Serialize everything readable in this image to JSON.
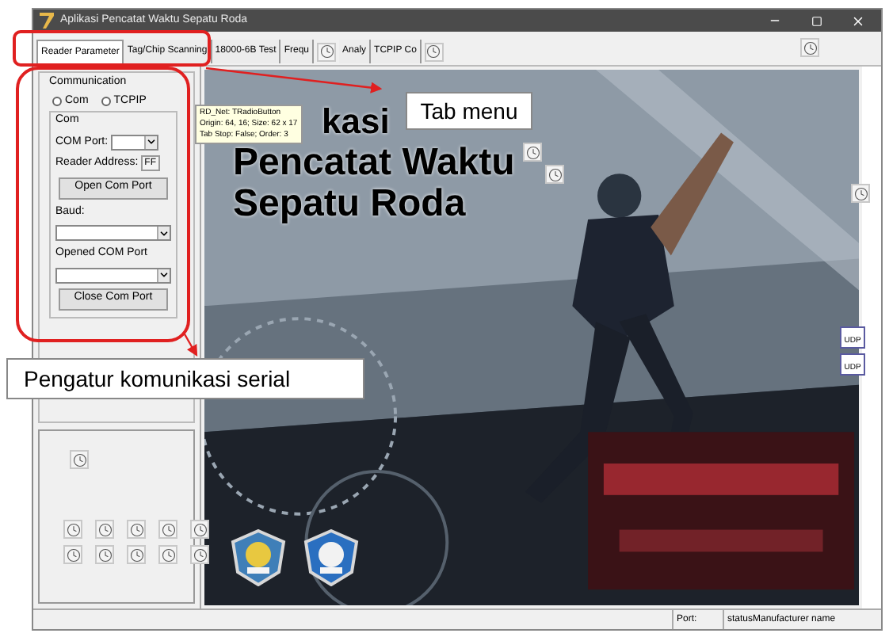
{
  "window": {
    "title": "Aplikasi Pencatat Waktu Sepatu Roda"
  },
  "tabs": [
    {
      "label": "Reader Parameter",
      "selected": true
    },
    {
      "label": "Tag/Chip Scanning",
      "selected": false
    },
    {
      "label": "18000-6B Test",
      "selected": false
    },
    {
      "label": "Frequ",
      "selected": false
    },
    {
      "label": "Analy",
      "selected": false
    },
    {
      "label": "TCPIP Co",
      "selected": false
    }
  ],
  "communication": {
    "title": "Communication",
    "radios": [
      {
        "label": "Com",
        "selected": false
      },
      {
        "label": "TCPIP",
        "selected": false
      }
    ],
    "com_group": {
      "title": "Com",
      "com_port_label": "COM Port:",
      "reader_address_label": "Reader Address:",
      "reader_address_value": "FF",
      "open_button": "Open Com Port",
      "baud_label": "Baud:",
      "opened_port_label": "Opened COM Port",
      "close_button": "Close Com Port"
    }
  },
  "tooltip": {
    "lines": [
      "RD_Net: TRadioButton",
      "Origin: 64, 16; Size: 62 x 17",
      "Tab Stop: False; Order: 3"
    ]
  },
  "banner": {
    "lines": [
      "kasi",
      "Pencatat Waktu",
      "Sepatu Roda"
    ]
  },
  "udp_components": [
    {
      "label": "UDP"
    },
    {
      "label": "UDP"
    }
  ],
  "status_bar": {
    "port_label": "Port:",
    "manufacturer": "statusManufacturer name"
  },
  "annotations": [
    {
      "text": "Tab menu"
    },
    {
      "text": "Pengatur komunikasi serial"
    }
  ]
}
